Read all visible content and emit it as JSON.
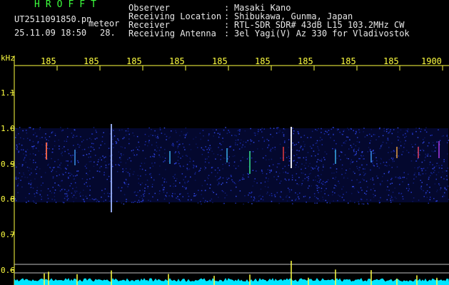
{
  "brand": "HROFFT",
  "file_name": "UT2511091850.pn",
  "mode": "meteor",
  "date_time": "25.11.09 18:50",
  "level": "28.",
  "header": [
    {
      "label": "Observer",
      "sep": ":",
      "value": "Masaki Kano"
    },
    {
      "label": "Receiving Location",
      "sep": ":",
      "value": "Shibukawa, Gunma, Japan"
    },
    {
      "label": "Receiver",
      "sep": ":",
      "value": "RTL-SDR SDR# 43dB L15 103.2MHz CW"
    },
    {
      "label": "Receiving Antenna",
      "sep": ":",
      "value": "3el Yagi(V) Az 330 for Vladivostok"
    }
  ],
  "y_axis": {
    "unit": "kHz",
    "ticks": [
      "1.1",
      "1.0",
      "0.9",
      "0.8",
      "0.7",
      "0.6"
    ]
  },
  "x_axis": {
    "ticks": [
      "185",
      "185",
      "185",
      "185",
      "185",
      "185",
      "185",
      "185",
      "185",
      "1900"
    ]
  },
  "colors": {
    "background": "#000000",
    "axis": "#ffff40",
    "text": "#e8e8e8",
    "brand": "#3cff3c",
    "noise": "#1a2aa8",
    "echo": "#ffffff",
    "spectrum": "#00e5ff"
  }
}
